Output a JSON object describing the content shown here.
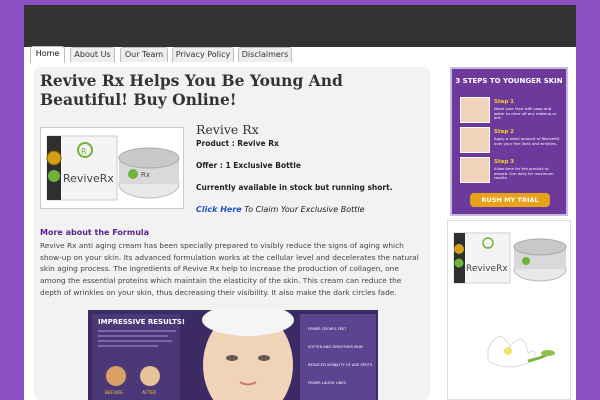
{
  "nav": {
    "tabs": [
      "Home",
      "About Us",
      "Our Team",
      "Privacy Policy",
      "Disclaimers"
    ],
    "active": "Home"
  },
  "article": {
    "title": "Revive Rx Helps You Be Young And Beautiful! Buy Online!",
    "product_name": "Revive Rx",
    "product_line": "Product : Revive Rx",
    "offer_line": "Offer : 1 Exclusive Bottle",
    "stock_line": "Currently available in stock but running short.",
    "claim_link": "Click Here",
    "claim_text": "To Claim Your Exclusive Bottle",
    "more_heading": "More about the Formula",
    "description": "Revive Rx anti aging cream has been specially prepared to visibly reduce the signs of aging which show-up on your skin. Its advanced formulation works at the cellular level and decelerates the natural skin aging process. The ingredients of Revive Rx help to increase the production of collagen, one among the essential proteins which maintain the elasticity of the skin. This cream can reduce the depth of wrinkles on your skin, thus decreasing their visibility. It also make the dark circles fade."
  },
  "product_image": {
    "brand": "ReviveRx"
  },
  "results_image": {
    "heading": "IMPRESSIVE RESULTS!",
    "before": "BEFORE",
    "after": "AFTER",
    "callouts": [
      "FEWER CROW'S FEET",
      "SOFTER AND SMOOTHER SKIN",
      "REDUCED VISIBILITY OF AGE SPOTS",
      "FEWER LAUGH LINES"
    ]
  },
  "sidebar": {
    "banner_heading": "3 STEPS TO YOUNGER SKIN",
    "steps": [
      {
        "label": "Step 1",
        "text": "Wash your face with soap and water to clear off any makeup or dirt."
      },
      {
        "label": "Step 2",
        "text": "Apply a small amount of ReviveRX over your fine lines and wrinkles."
      },
      {
        "label": "Step 3",
        "text": "Allow time for the product to absorb. Use daily for maximum results."
      }
    ],
    "cta": "RUSH MY TRIAL",
    "product_brand": "ReviveRx"
  },
  "colors": {
    "page_bg": "#8a4fc3",
    "header_bg": "#333333",
    "accent_purple": "#5a1f8f",
    "link_blue": "#1a55c8",
    "cta_orange": "#e8a21a"
  }
}
